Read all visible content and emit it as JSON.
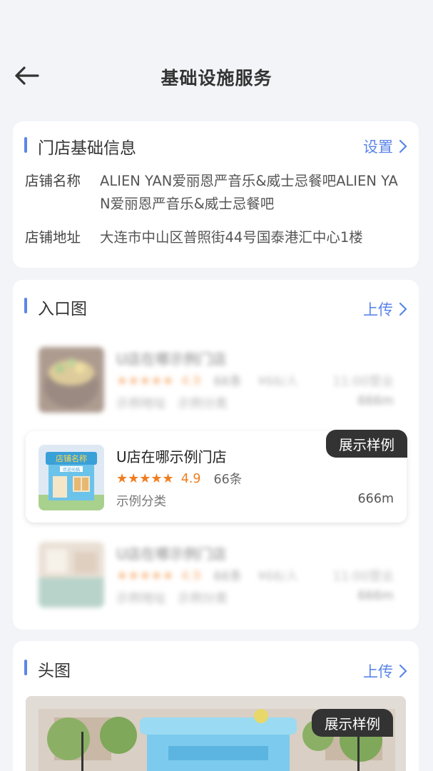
{
  "header": {
    "title": "基础设施服务"
  },
  "basic_info": {
    "title": "门店基础信息",
    "action_label": "设置",
    "name_label": "店铺名称",
    "name_value": "ALIEN YAN爱丽恩严音乐&威士忌餐吧ALIEN YAN爱丽恩严音乐&威士忌餐吧",
    "address_label": "店铺地址",
    "address_value": "大连市中山区普照街44号国泰港汇中心1楼"
  },
  "entrance": {
    "title": "入口图",
    "action_label": "上传",
    "sample_tag": "展示样例",
    "stores": [
      {
        "name": "U店在哪示例门店",
        "score": "4.9",
        "count": "66条",
        "price": "¥66/人",
        "open": "11:00营业",
        "addr": "示例地址",
        "category": "示例分类",
        "distance": "666m"
      },
      {
        "name": "U店在哪示例门店",
        "score": "4.9",
        "count": "66条",
        "category": "示例分类",
        "distance": "666m",
        "thumb_sign": "店铺名称",
        "thumb_subsign": "欢迎光临"
      },
      {
        "name": "U店在哪示例门店",
        "score": "4.9",
        "count": "66条",
        "price": "¥66/人",
        "open": "11:00营业",
        "addr": "示例地址",
        "category": "示例分类",
        "distance": "666m"
      }
    ]
  },
  "head_image": {
    "title": "头图",
    "action_label": "上传",
    "sample_tag": "展示样例"
  },
  "colors": {
    "accent": "#5b86e8",
    "star": "#f07d1f",
    "background": "#f2f4f8"
  }
}
